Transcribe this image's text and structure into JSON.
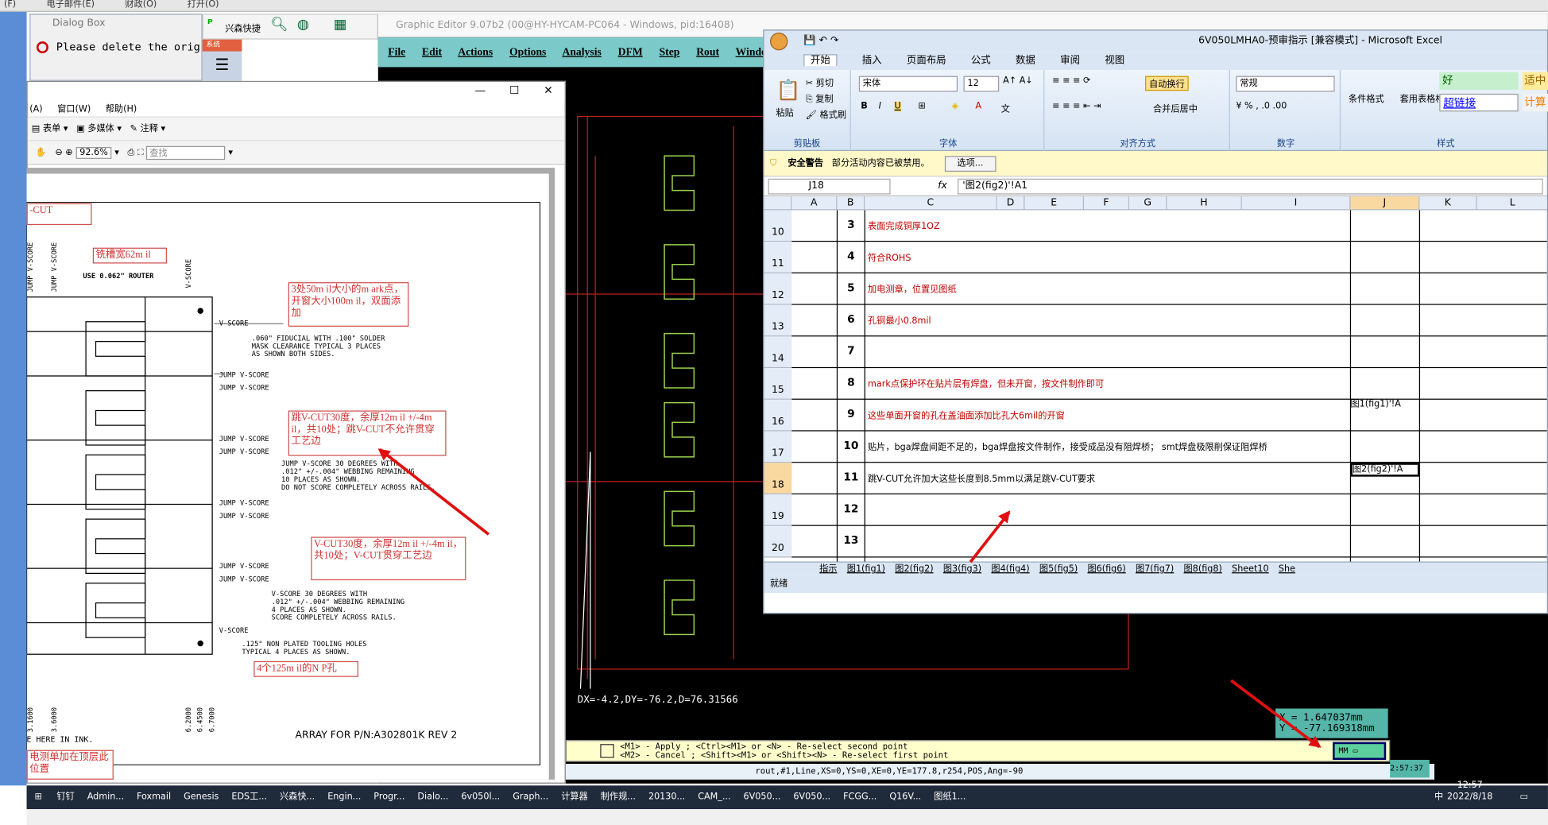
{
  "top_strip": {
    "items": [
      "(F)",
      "电子邮件(E)",
      "财政(O)",
      "打开(O)"
    ]
  },
  "dialog": {
    "title": "Dialog Box",
    "message": "Please delete the orig"
  },
  "xs_toolbar": {
    "label": "兴森快捷",
    "side_label": "系统"
  },
  "graphic_editor": {
    "title": "Graphic Editor 9.07b2 (00@HY-HYCAM-PC064 - Windows, pid:16408)",
    "menu": [
      "File",
      "Edit",
      "Actions",
      "Options",
      "Analysis",
      "DFM",
      "Step",
      "Rout",
      "Windows"
    ],
    "dx_readout": "DX=-4.2,DY=-76.2,D=76.31566",
    "coord_x": "X = 1.647037mm",
    "coord_y": "Y = -77.169318mm",
    "cmd_line1": "<M1> - Apply  ; <Ctrl><M1> or <N> - Re-select second point",
    "cmd_line2": "<M2> - Cancel ; <Shift><M1> or <Shift><N> - Re-select first point",
    "units": "MM",
    "status": "rout,#1,Line,XS=0,YS=0,XE=0,YE=177.8,r254,POS,Ang=-90",
    "time": "2:57:37"
  },
  "pdf": {
    "menu": [
      "(A)",
      "窗口(W)",
      "帮助(H)"
    ],
    "tools": [
      "表单",
      "多媒体",
      "注释"
    ],
    "zoom": "92.6%",
    "find_placeholder": "查找",
    "labels": {
      "vcut": "-CUT",
      "router_note": "铣槽宽62m il",
      "use_router": "USE 0.062\" ROUTER",
      "jump_vscore_1": "JUMP V-SCORE",
      "jump_vscore_2": "JUMP V-SCORE",
      "vscore_top": "V-SCORE",
      "fiducial": ".060\" FIDUCIAL WITH .100\" SOLDER",
      "fiducial2": "MASK CLEARANCE TYPICAL 3 PLACES",
      "fiducial3": "AS SHOWN BOTH SIDES.",
      "mark_note": "3处50m il大小的m ark点，开窗大小100m il，双面添加",
      "jump_note": "跳V-CUT30度，余厚12m il +/-4m il，共10处；跳V-CUT不允许贯穿工艺边",
      "jump_text1": "JUMP V-SCORE 30 DEGREES WITH",
      "jump_text2": ".012\" +/-.004\" WEBBING REMAINING",
      "jump_text3": "10 PLACES AS SHOWN.",
      "jump_text4": "DO NOT SCORE COMPLETELY ACROSS RAILS.",
      "vcut_note": "V-CUT30度，余厚12m il +/-4m il，共10处；V-CUT贯穿工艺边",
      "vs_text1": "V-SCORE 30 DEGREES WITH",
      "vs_text2": ".012\" +/-.004\" WEBBING REMAINING",
      "vs_text3": "4 PLACES AS SHOWN.",
      "vs_text4": "SCORE COMPLETELY ACROSS RAILS.",
      "vscore_bottom": "V-SCORE",
      "tooling": ".125\" NON PLATED TOOLING HOLES",
      "tooling2": "TYPICAL 4 PLACES AS SHOWN.",
      "npth_note": "4个125m il的N P孔",
      "ink": "E HERE IN INK.",
      "array": "ARRAY FOR P/N:A302801K REV 2",
      "test_note": "电测单加在顶层此位置",
      "dim1": "3.1600",
      "dim2": "3.6000",
      "dim3": "6.2000",
      "dim4": "6.4500",
      "dim5": "6.7000"
    }
  },
  "excel": {
    "title": "6V050LMHA0-预审指示 [兼容模式] - Microsoft Excel",
    "tabs": [
      "开始",
      "插入",
      "页面布局",
      "公式",
      "数据",
      "审阅",
      "视图"
    ],
    "clipboard": {
      "paste": "粘贴",
      "cut": "剪切",
      "copy": "复制",
      "format": "格式刷",
      "label": "剪贴板"
    },
    "font": {
      "name": "宋体",
      "size": "12",
      "label": "字体"
    },
    "align": {
      "wrap": "自动换行",
      "merge": "合并后居中",
      "label": "对齐方式"
    },
    "number": {
      "format": "常规",
      "label": "数字"
    },
    "styles": {
      "cond": "条件格式",
      "table": "套用表格格式",
      "good": "好",
      "neutral": "适中",
      "link": "超链接",
      "calc": "计算",
      "label": "样式"
    },
    "security": {
      "title": "安全警告",
      "msg": "部分活动内容已被禁用。",
      "btn": "选项..."
    },
    "name_box": "J18",
    "formula": "'图2(fig2)'!A1",
    "columns": [
      "A",
      "B",
      "C",
      "D",
      "E",
      "F",
      "G",
      "H",
      "I",
      "J",
      "K",
      "L"
    ],
    "rows": [
      {
        "row": "10",
        "num": "3",
        "text": "表面完成铜厚1OZ",
        "red": true,
        "j": ""
      },
      {
        "row": "11",
        "num": "4",
        "text": "符合ROHS",
        "red": true,
        "j": ""
      },
      {
        "row": "12",
        "num": "5",
        "text": "加电测章，位置见图纸",
        "red": true,
        "j": ""
      },
      {
        "row": "13",
        "num": "6",
        "text": "孔铜最小0.8mil",
        "red": true,
        "j": ""
      },
      {
        "row": "14",
        "num": "7",
        "text": "",
        "red": false,
        "j": ""
      },
      {
        "row": "15",
        "num": "8",
        "text": "mark点保护环在贴片层有焊盘，但未开窗，按文件制作即可",
        "red": true,
        "j": ""
      },
      {
        "row": "16",
        "num": "9",
        "text": "这些单面开窗的孔在盖油面添加比孔大6mil的开窗",
        "red": true,
        "j": "图1(fig1)'!A"
      },
      {
        "row": "17",
        "num": "10",
        "text": "贴片，bga焊盘间距不足的，bga焊盘按文件制作，接受成品没有阻焊桥； smt焊盘极限削保证阻焊桥",
        "red": false,
        "j": ""
      },
      {
        "row": "18",
        "num": "11",
        "text": "跳V-CUT允许加大这些长度到8.5mm以满足跳V-CUT要求",
        "red": false,
        "j": "图2(fig2)'!A"
      },
      {
        "row": "19",
        "num": "12",
        "text": "",
        "red": false,
        "j": ""
      },
      {
        "row": "20",
        "num": "13",
        "text": "",
        "red": false,
        "j": ""
      }
    ],
    "sheets": [
      "指示",
      "图1(fig1)",
      "图2(fig2)",
      "图3(fig3)",
      "图4(fig4)",
      "图5(fig5)",
      "图6(fig6)",
      "图7(fig7)",
      "图8(fig8)",
      "Sheet10",
      "She"
    ],
    "status": "就绪"
  },
  "taskbar": {
    "items": [
      "钉钉",
      "Admin...",
      "Foxmail",
      "Genesis",
      "EDS工...",
      "兴森快...",
      "Engin...",
      "Progr...",
      "Dialo...",
      "6v050l...",
      "Graph...",
      "计算器",
      "制作规...",
      "20130...",
      "CAM_...",
      "6V050...",
      "6V050...",
      "FCGG...",
      "Q16V...",
      "图纸1..."
    ],
    "time": "12:57",
    "date": "2022/8/18",
    "ime": "中"
  },
  "colors": {
    "excel_red": "#c00000",
    "cad_bg": "#000000",
    "annotation_red": "#e01010"
  }
}
